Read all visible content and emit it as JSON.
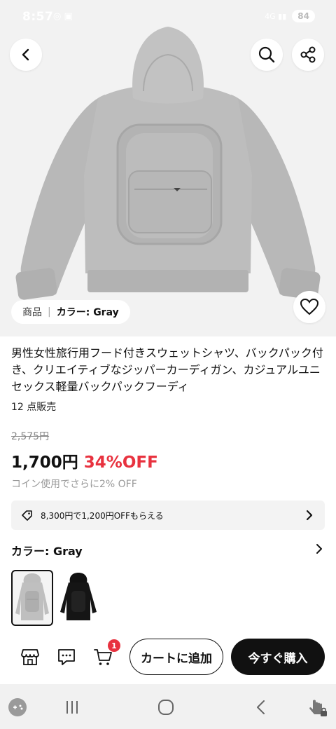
{
  "status_bar": {
    "time": "8:57",
    "battery": "84"
  },
  "hero": {
    "tag_label": "商品",
    "tag_color": "カラー: Gray"
  },
  "product": {
    "title": "男性女性旅行用フード付きスウェットシャツ、バックパック付き、クリエイティブなジッパーカーディガン、カジュアルユニセックス軽量バックパックフーディ",
    "sold": "12 点販売",
    "original_price": "2,575円",
    "price": "1,700円",
    "discount": "34%OFF",
    "coin_note": "コイン使用でさらに2% OFF"
  },
  "coupon": {
    "text": "8,300円で1,200円OFFもらえる"
  },
  "color_selector": {
    "label": "カラー: Gray",
    "options": [
      "Gray",
      "Black"
    ],
    "selected": "Gray"
  },
  "action_bar": {
    "cart_count": "1",
    "add_to_cart": "カートに追加",
    "buy_now": "今すぐ購入"
  },
  "colors": {
    "accent_red": "#e8323f",
    "dark": "#111111",
    "hoodie_gray": "#b9b9b9"
  }
}
